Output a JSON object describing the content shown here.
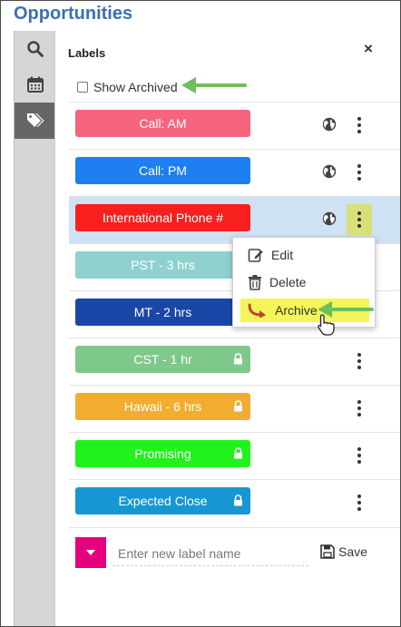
{
  "app": {
    "title": "Opportunities"
  },
  "rail": {
    "items": [
      {
        "icon": "search-icon"
      },
      {
        "icon": "calendar-icon"
      },
      {
        "icon": "tags-icon",
        "active": true
      }
    ]
  },
  "panel": {
    "title": "Labels",
    "close_label": "×",
    "show_archived_label": "Show Archived",
    "show_archived_checked": false
  },
  "labels": [
    {
      "name": "Call: AM",
      "color": "#f7647e",
      "shared": true,
      "locked": false
    },
    {
      "name": "Call: PM",
      "color": "#1e7ff0",
      "shared": true,
      "locked": false
    },
    {
      "name": "International Phone #",
      "color": "#f7201e",
      "shared": true,
      "locked": false,
      "highlighted": true
    },
    {
      "name": "PST - 3 hrs",
      "color": "#8ed1cf",
      "shared": false,
      "locked": false
    },
    {
      "name": "MT - 2 hrs",
      "color": "#1a47a7",
      "shared": false,
      "locked": false
    },
    {
      "name": "CST - 1 hr",
      "color": "#7fc88b",
      "shared": false,
      "locked": true
    },
    {
      "name": "Hawaii - 6 hrs",
      "color": "#f0ad2f",
      "shared": false,
      "locked": true
    },
    {
      "name": "Promising",
      "color": "#22f21b",
      "shared": false,
      "locked": true
    },
    {
      "name": "Expected Close",
      "color": "#1796d4",
      "shared": false,
      "locked": true
    }
  ],
  "context_menu": {
    "items": [
      {
        "label": "Edit",
        "icon": "edit-icon"
      },
      {
        "label": "Delete",
        "icon": "trash-icon"
      },
      {
        "label": "Archive",
        "icon": "archive-arrow-icon",
        "selected": true
      }
    ]
  },
  "new_label": {
    "placeholder": "Enter new label name",
    "value": "",
    "color": "#e6007e",
    "save_label": "Save"
  },
  "colors": {
    "accent": "#3b6fb6",
    "annotation_arrow": "#6cbf5b",
    "menu_highlight": "#f3f55a",
    "row_highlight": "#cfe2f3"
  }
}
